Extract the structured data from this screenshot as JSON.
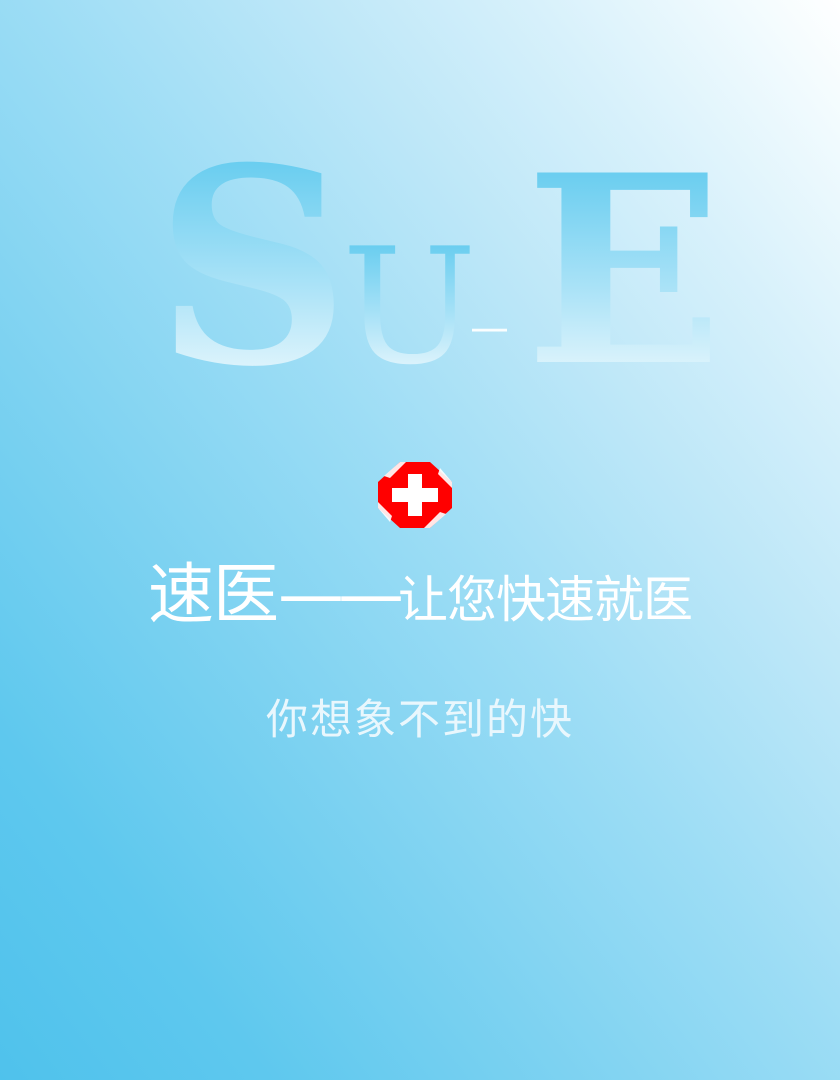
{
  "logo": {
    "letters": [
      "S",
      "U",
      "_",
      "E"
    ],
    "gradient_top": "#4dc4ec",
    "gradient_bottom": "#ffffff"
  },
  "emblem": {
    "icon": "red-cross-icon",
    "color": "#ff0000"
  },
  "headline": {
    "brand": "速医",
    "dash": "——",
    "slogan": "让您快速就医"
  },
  "tagline": "你想象不到的快",
  "colors": {
    "background_top_right": "#ffffff",
    "background_bottom_left": "#4fc2ec",
    "text": "#ffffff"
  }
}
